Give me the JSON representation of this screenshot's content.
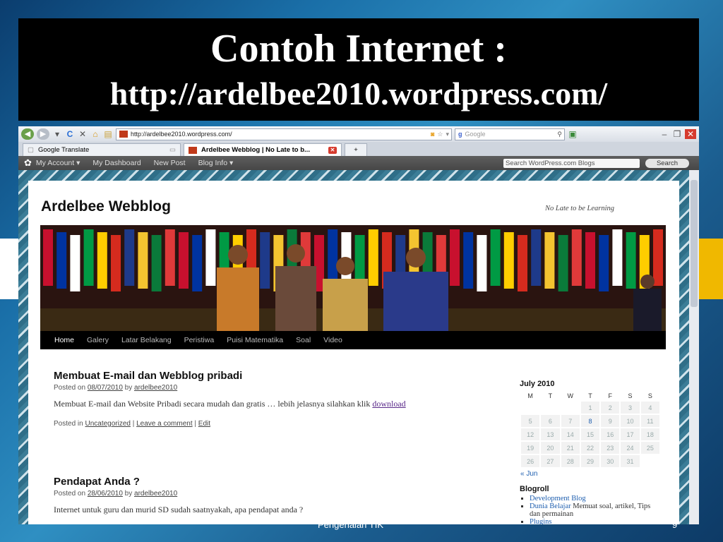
{
  "slide": {
    "title_line1": "Contoh Internet :",
    "title_line2": "http://ardelbee2010.wordpress.com/",
    "footer": "Pengenalan TIK",
    "page_number": "9"
  },
  "browser": {
    "url": "http://ardelbee2010.wordpress.com/",
    "search_placeholder": "Google",
    "tabs": [
      {
        "label": "Google Translate"
      },
      {
        "label": "Ardelbee Webblog | No Late to b..."
      }
    ],
    "new_tab_icon": "+"
  },
  "wp_bar": {
    "my_account": "My Account ▾",
    "my_dashboard": "My Dashboard",
    "new_post": "New Post",
    "blog_info": "Blog Info ▾",
    "search_placeholder": "Search WordPress.com Blogs",
    "search_button": "Search"
  },
  "site": {
    "title": "Ardelbee Webblog",
    "description": "No Late to be Learning",
    "menu": [
      "Home",
      "Galery",
      "Latar Belakang",
      "Peristiwa",
      "Puisi Matematika",
      "Soal",
      "Video"
    ]
  },
  "posts": [
    {
      "title": "Membuat E-mail dan Webblog pribadi",
      "posted_on": "Posted on",
      "date": "08/07/2010",
      "by": "by",
      "author": "ardelbee2010",
      "body": "Membuat E-mail dan Website Pribadi secara mudah dan gratis … lebih jelasnya silahkan klik",
      "link": "download",
      "posted_in": "Posted in",
      "category": "Uncategorized",
      "comment": "Leave a comment",
      "edit": "Edit"
    },
    {
      "title": "Pendapat Anda ?",
      "posted_on": "Posted on",
      "date": "28/06/2010",
      "by": "by",
      "author": "ardelbee2010",
      "body": "Internet untuk guru dan murid SD sudah saatnyakah, apa pendapat anda ?"
    }
  ],
  "calendar": {
    "title": "July 2010",
    "days": [
      "M",
      "T",
      "W",
      "T",
      "F",
      "S",
      "S"
    ],
    "weeks": [
      [
        "",
        "",
        "",
        "1",
        "2",
        "3",
        "4"
      ],
      [
        "5",
        "6",
        "7",
        "8",
        "9",
        "10",
        "11"
      ],
      [
        "12",
        "13",
        "14",
        "15",
        "16",
        "17",
        "18"
      ],
      [
        "19",
        "20",
        "21",
        "22",
        "23",
        "24",
        "25"
      ],
      [
        "26",
        "27",
        "28",
        "29",
        "30",
        "31",
        ""
      ]
    ],
    "prev": "« Jun"
  },
  "blogroll": {
    "title": "Blogroll",
    "items": [
      {
        "link": "Development Blog",
        "desc": ""
      },
      {
        "link": "Dunia Belajar",
        "desc": "Memuat soal, artikel, Tips dan permainan"
      },
      {
        "link": "Plugins",
        "desc": ""
      }
    ]
  },
  "colors": {
    "slide_title_bg": "#000000",
    "wp_admin_bar": "#464646",
    "site_menu_bg": "#000000",
    "link_blue": "#2060b0"
  }
}
